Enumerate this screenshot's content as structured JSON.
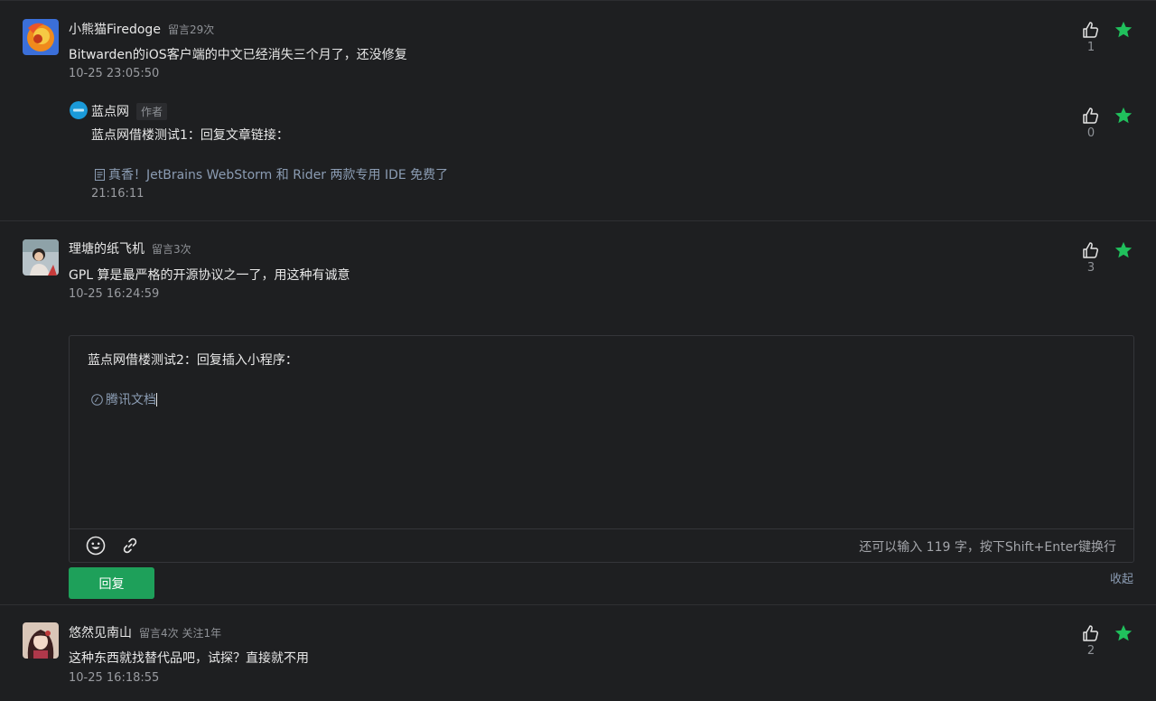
{
  "colors": {
    "accent_green": "#1ea05a",
    "star_green": "#20c05c",
    "link": "#8b9cb3",
    "background": "#1e1f21"
  },
  "comments": [
    {
      "user": "小熊猫Firedoge",
      "meta": "留言29次",
      "text": "Bitwarden的iOS客户端的中文已经消失三个月了，还没修复",
      "time": "10-25 23:05:50",
      "likes": "1",
      "reply": {
        "user": "蓝点网",
        "author_tag": "作者",
        "text": "蓝点网借楼测试1：回复文章链接：",
        "link_text": "真香！JetBrains WebStorm 和 Rider 两款专用 IDE 免费了",
        "time": "21:16:11",
        "likes": "0"
      }
    },
    {
      "user": "理塘的纸飞机",
      "meta": "留言3次",
      "text": "GPL 算是最严格的开源协议之一了，用这种有诚意",
      "time": "10-25 16:24:59",
      "likes": "3"
    },
    {
      "user": "悠然见南山",
      "meta": "留言4次 关注1年",
      "text": "这种东西就找替代品吧，试探？直接就不用",
      "time": "10-25 16:18:55",
      "likes": "2"
    }
  ],
  "editor": {
    "text": "蓝点网借楼测试2：回复插入小程序：",
    "miniprogram_label": "腾讯文档",
    "char_hint": "还可以输入 119 字，按下Shift+Enter键换行",
    "emoji_icon": "smiley-icon",
    "link_icon": "link-icon"
  },
  "buttons": {
    "reply": "回复",
    "collapse": "收起"
  }
}
